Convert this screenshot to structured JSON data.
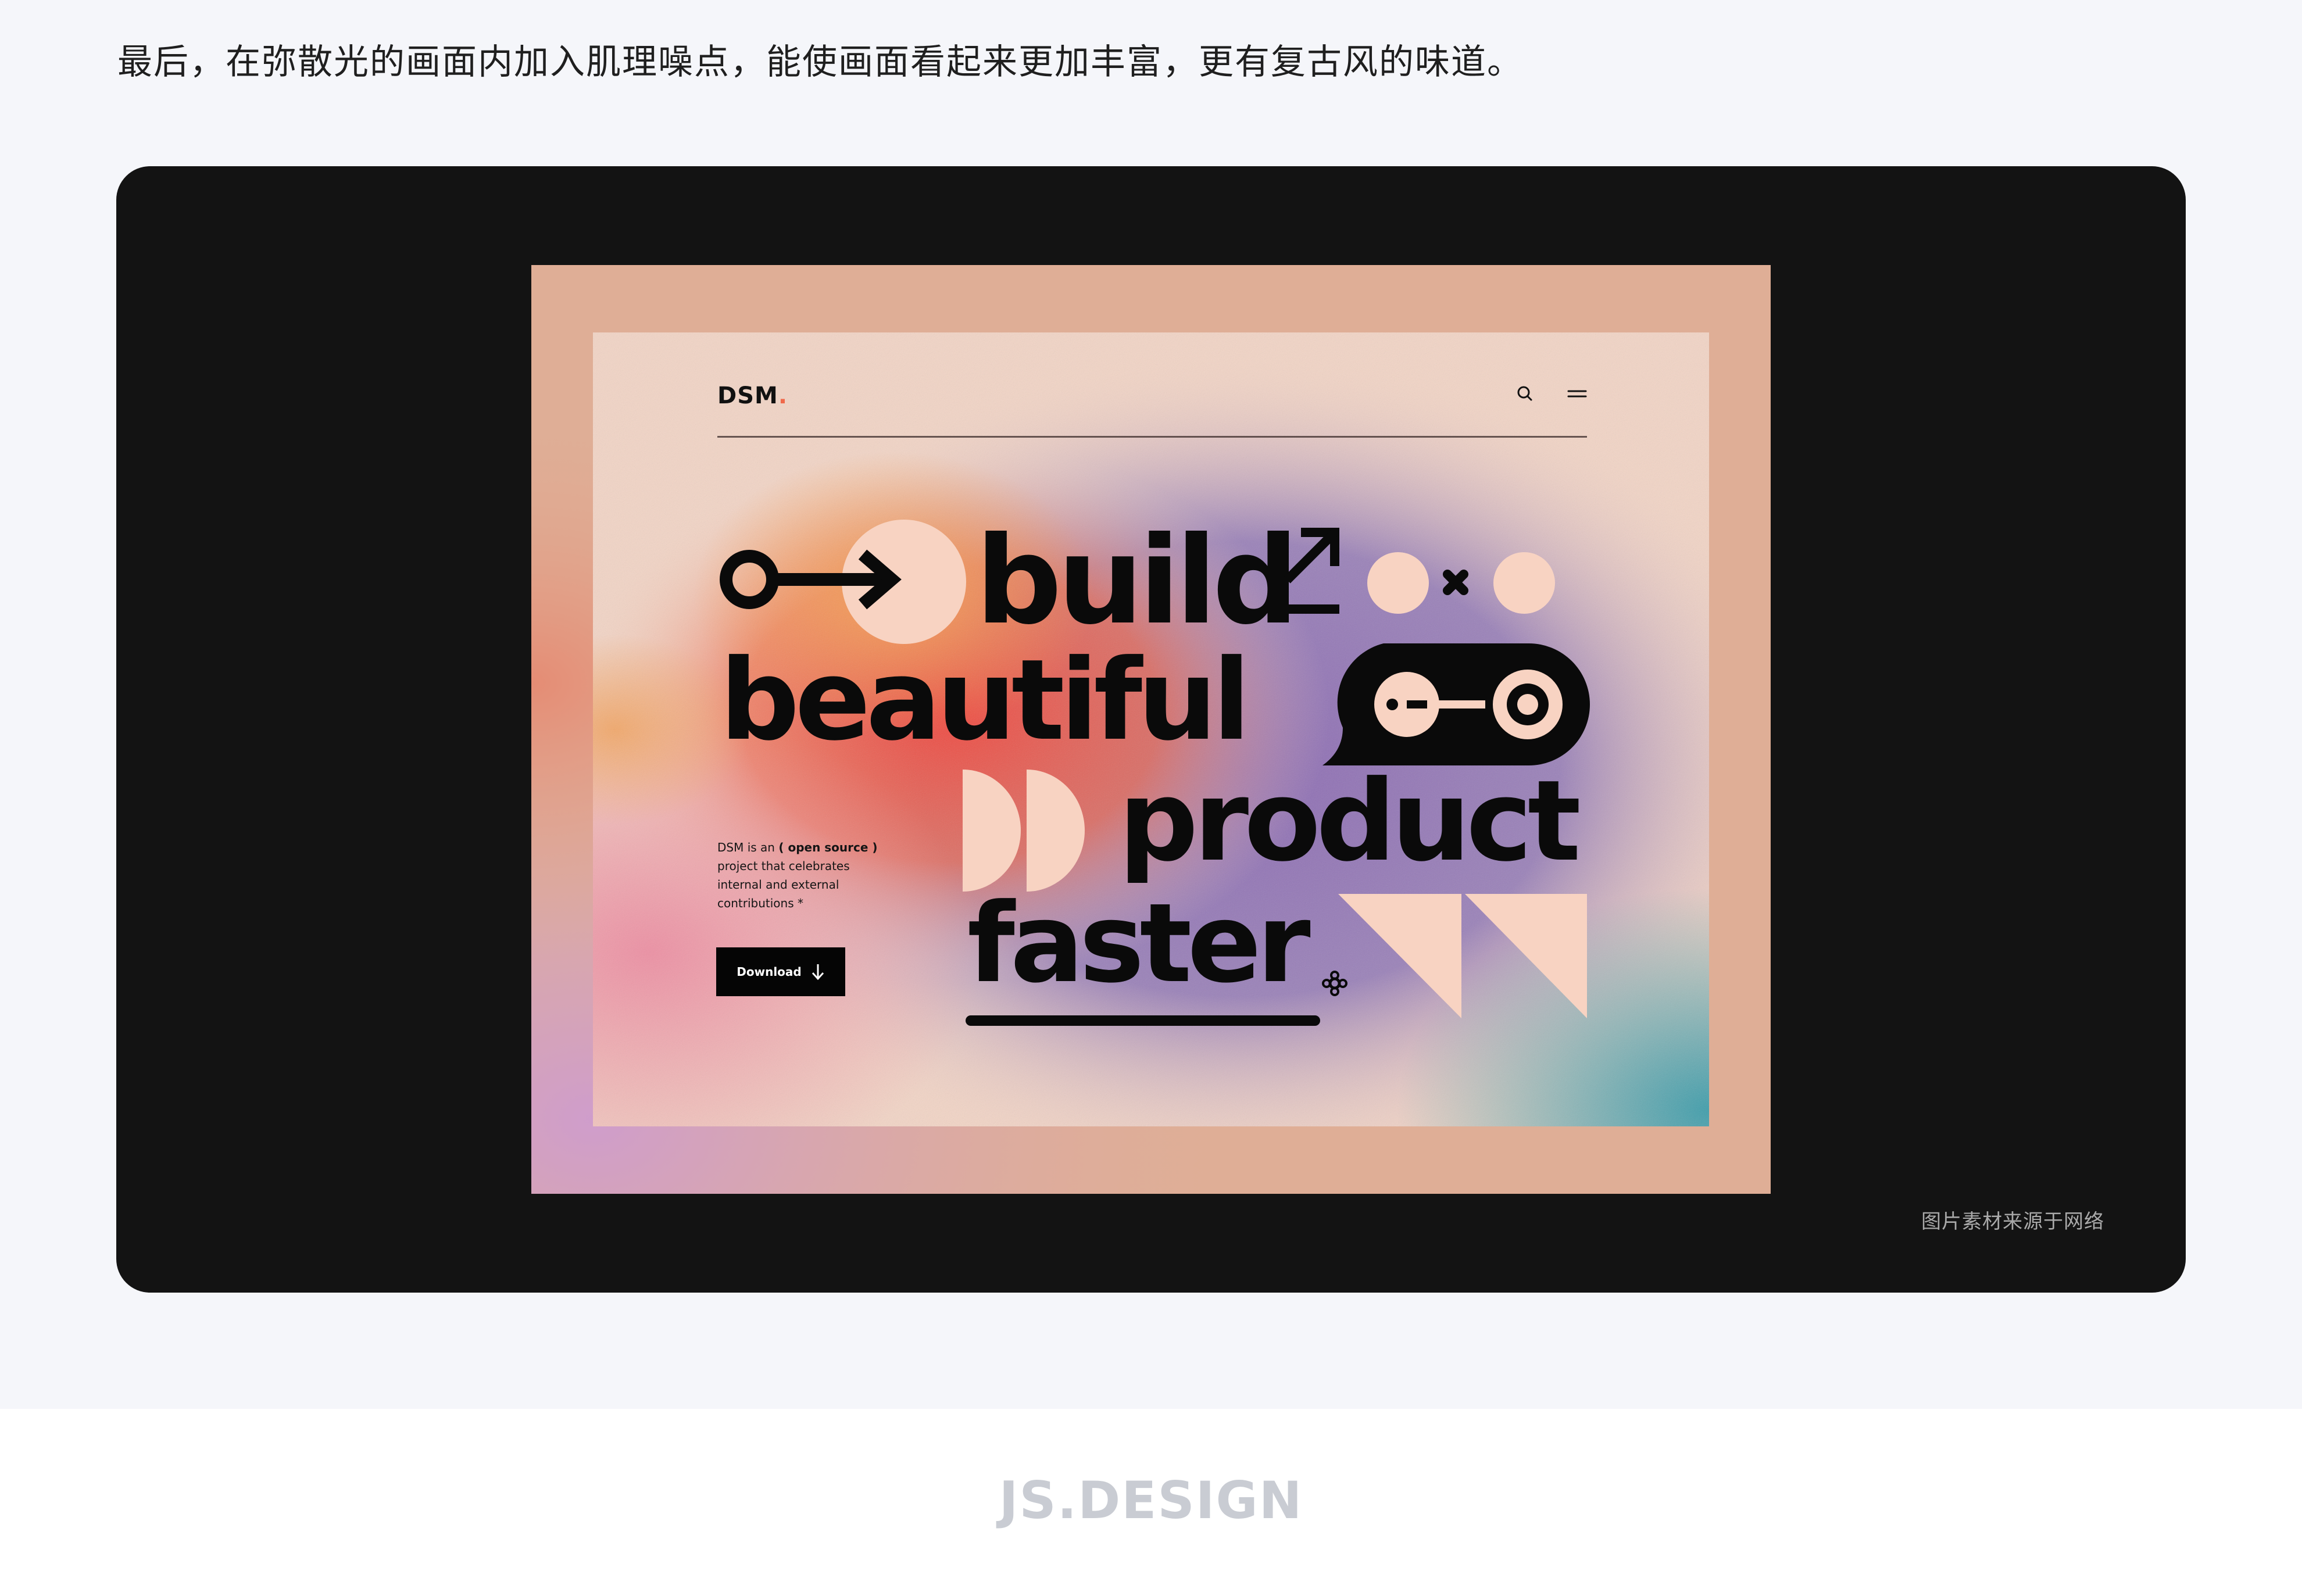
{
  "intro_text": "最后，在弥散光的画面内加入肌理噪点，能使画面看起来更加丰富，更有复古风的味道。",
  "caption": "图片素材来源于网络",
  "footer_brand": "JS.DESIGN",
  "mockup": {
    "logo_text": "DSM",
    "logo_dot": ".",
    "icons": [
      "search-icon",
      "menu-icon",
      "download-arrow-icon",
      "open-circle-arrow-icon",
      "diagonal-arrow-icon"
    ],
    "headline": {
      "line1": "build",
      "line2": "beautiful",
      "line3": "product",
      "line4": "faster"
    },
    "description": {
      "part1": "DSM is an ",
      "highlight": "( open source )",
      "part2": " project that celebrates internal and external contributions *"
    },
    "download_label": "Download",
    "colors": {
      "peach": "#f8d3c2",
      "frame": "#dfae96",
      "orange_glow": "#f6903c",
      "red_glow": "#f0463e",
      "purple_glow": "#8c6ab3",
      "teal_glow": "#3d9dab",
      "ink": "#0a0a0a"
    }
  }
}
